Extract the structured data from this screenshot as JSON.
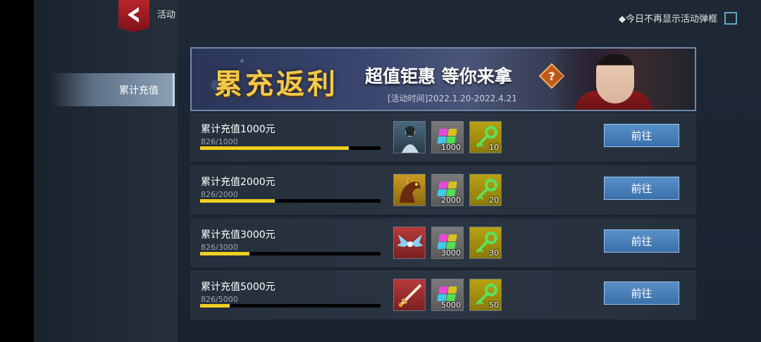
{
  "header": {
    "title": "活动",
    "no_show_label": "◆今日不再显示活动弹框"
  },
  "sidebar": {
    "items": [
      {
        "label": "累计充值",
        "active": true
      }
    ]
  },
  "banner": {
    "main_text": "累充返利",
    "sub_text": "超值钜惠 等你来拿",
    "date_text": "[活动时间]2022.1.20-2022.4.21",
    "help_symbol": "?"
  },
  "rows": [
    {
      "title": "累计充值1000元",
      "progress_text": "826/1000",
      "progress": 0.826,
      "rewards": [
        {
          "icon": "character-icon"
        },
        {
          "icon": "gem-pack-icon",
          "count": "1000"
        },
        {
          "icon": "key-icon",
          "count": "10"
        }
      ],
      "button": "前往"
    },
    {
      "title": "累计充值2000元",
      "progress_text": "826/2000",
      "progress": 0.413,
      "rewards": [
        {
          "icon": "mount-icon"
        },
        {
          "icon": "gem-pack-icon",
          "count": "2000"
        },
        {
          "icon": "key-icon",
          "count": "20"
        }
      ],
      "button": "前往"
    },
    {
      "title": "累计充值3000元",
      "progress_text": "826/3000",
      "progress": 0.2753,
      "rewards": [
        {
          "icon": "wings-icon"
        },
        {
          "icon": "gem-pack-icon",
          "count": "3000"
        },
        {
          "icon": "key-icon",
          "count": "30"
        }
      ],
      "button": "前往"
    },
    {
      "title": "累计充值5000元",
      "progress_text": "826/5000",
      "progress": 0.1652,
      "rewards": [
        {
          "icon": "weapon-icon"
        },
        {
          "icon": "gem-pack-icon",
          "count": "5000"
        },
        {
          "icon": "key-icon",
          "count": "50"
        }
      ],
      "button": "前往"
    }
  ],
  "colors": {
    "accent_blue": "#4a80bb",
    "progress_yellow": "#f0d020",
    "back_red": "#b8242b"
  }
}
